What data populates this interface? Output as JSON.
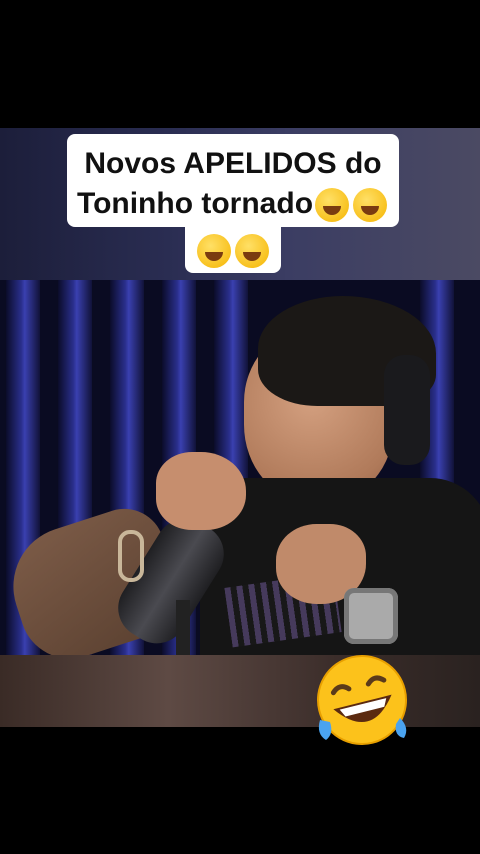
{
  "caption": {
    "line1": "Novos APELIDOS do",
    "line2": "Toninho tornado",
    "line2_emoji_count": 2,
    "line3_emoji_count": 2
  },
  "sticker": {
    "icon": "rolling-laughing-emoji"
  },
  "colors": {
    "background": "#000000",
    "caption_bg": "#ffffff",
    "caption_text": "#111111",
    "backdrop_blue": "#3a40b0"
  }
}
